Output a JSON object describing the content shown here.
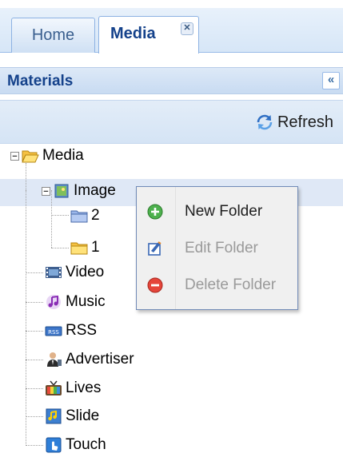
{
  "tabs": [
    {
      "label": "Home"
    },
    {
      "label": "Media",
      "close_icon": "close-icon"
    }
  ],
  "panel": {
    "title": "Materials",
    "collapse_icon": "double-chevron-left-icon"
  },
  "toolbar": {
    "refresh_label": "Refresh",
    "refresh_icon": "refresh-icon"
  },
  "tree": {
    "root": {
      "label": "Media",
      "icon": "folder-open-icon"
    },
    "image": {
      "label": "Image",
      "icon": "image-icon"
    },
    "folder_2": {
      "label": "2",
      "icon": "folder-blue-icon"
    },
    "folder_1": {
      "label": "1",
      "icon": "folder-yellow-icon"
    },
    "items": [
      {
        "label": "Video",
        "icon": "film-icon"
      },
      {
        "label": "Music",
        "icon": "music-icon"
      },
      {
        "label": "RSS",
        "icon": "rss-icon"
      },
      {
        "label": "Advertiser",
        "icon": "advertiser-icon"
      },
      {
        "label": "Lives",
        "icon": "tv-icon"
      },
      {
        "label": "Slide",
        "icon": "slide-icon"
      },
      {
        "label": "Touch",
        "icon": "touch-icon"
      }
    ]
  },
  "context_menu": {
    "items": [
      {
        "label": "New Folder",
        "icon": "add-icon",
        "enabled": true
      },
      {
        "label": "Edit Folder",
        "icon": "edit-icon",
        "enabled": false
      },
      {
        "label": "Delete Folder",
        "icon": "delete-icon",
        "enabled": false
      }
    ]
  },
  "colors": {
    "header_text": "#15428b",
    "border": "#99bbe8",
    "selection": "#dfe8f6"
  }
}
